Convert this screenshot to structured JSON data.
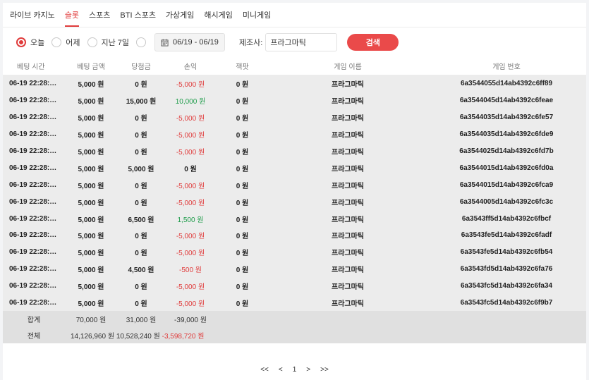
{
  "tabs": [
    {
      "label": "라이브 카지노",
      "active": false
    },
    {
      "label": "슬롯",
      "active": true
    },
    {
      "label": "스포츠",
      "active": false
    },
    {
      "label": "BTI 스포츠",
      "active": false
    },
    {
      "label": "가상게임",
      "active": false
    },
    {
      "label": "해시게임",
      "active": false
    },
    {
      "label": "미니게임",
      "active": false
    }
  ],
  "filters": {
    "today": "오늘",
    "yesterday": "어제",
    "last7": "지난 7일",
    "date_range": "06/19 - 06/19",
    "maker_label": "제조사:",
    "maker_value": "프라그마틱",
    "search_label": "검색"
  },
  "table": {
    "headers": [
      "베팅 시간",
      "베팅 금액",
      "당첨금",
      "손익",
      "잭팟",
      "게임 이름",
      "게임 번호"
    ],
    "rows": [
      [
        "06-19 22:28:…",
        "5,000 원",
        "0 원",
        "-5,000 원",
        "0 원",
        "프라그마틱",
        "6a3544055d14ab4392c6ff89"
      ],
      [
        "06-19 22:28:…",
        "5,000 원",
        "15,000 원",
        "10,000 원",
        "0 원",
        "프라그마틱",
        "6a3544045d14ab4392c6feae"
      ],
      [
        "06-19 22:28:…",
        "5,000 원",
        "0 원",
        "-5,000 원",
        "0 원",
        "프라그마틱",
        "6a3544035d14ab4392c6fe57"
      ],
      [
        "06-19 22:28:…",
        "5,000 원",
        "0 원",
        "-5,000 원",
        "0 원",
        "프라그마틱",
        "6a3544035d14ab4392c6fde9"
      ],
      [
        "06-19 22:28:…",
        "5,000 원",
        "0 원",
        "-5,000 원",
        "0 원",
        "프라그마틱",
        "6a3544025d14ab4392c6fd7b"
      ],
      [
        "06-19 22:28:…",
        "5,000 원",
        "5,000 원",
        "0 원",
        "0 원",
        "프라그마틱",
        "6a3544015d14ab4392c6fd0a"
      ],
      [
        "06-19 22:28:…",
        "5,000 원",
        "0 원",
        "-5,000 원",
        "0 원",
        "프라그마틱",
        "6a3544015d14ab4392c6fca9"
      ],
      [
        "06-19 22:28:…",
        "5,000 원",
        "0 원",
        "-5,000 원",
        "0 원",
        "프라그마틱",
        "6a3544005d14ab4392c6fc3c"
      ],
      [
        "06-19 22:28:…",
        "5,000 원",
        "6,500 원",
        "1,500 원",
        "0 원",
        "프라그마틱",
        "6a3543ff5d14ab4392c6fbcf"
      ],
      [
        "06-19 22:28:…",
        "5,000 원",
        "0 원",
        "-5,000 원",
        "0 원",
        "프라그마틱",
        "6a3543fe5d14ab4392c6fadf"
      ],
      [
        "06-19 22:28:…",
        "5,000 원",
        "0 원",
        "-5,000 원",
        "0 원",
        "프라그마틱",
        "6a3543fe5d14ab4392c6fb54"
      ],
      [
        "06-19 22:28:…",
        "5,000 원",
        "4,500 원",
        "-500 원",
        "0 원",
        "프라그마틱",
        "6a3543fd5d14ab4392c6fa76"
      ],
      [
        "06-19 22:28:…",
        "5,000 원",
        "0 원",
        "-5,000 원",
        "0 원",
        "프라그마틱",
        "6a3543fc5d14ab4392c6fa34"
      ],
      [
        "06-19 22:28:…",
        "5,000 원",
        "0 원",
        "-5,000 원",
        "0 원",
        "프라그마틱",
        "6a3543fc5d14ab4392c6f9b7"
      ]
    ],
    "subtotal": {
      "label": "합계",
      "bet": "70,000 원",
      "win": "31,000 원",
      "profit": "-39,000 원"
    },
    "total": {
      "label": "전체",
      "bet": "14,126,960 원",
      "win": "10,528,240 원",
      "profit": "-3,598,720 원"
    }
  },
  "pager": {
    "first": "<<",
    "prev": "<",
    "page": "1",
    "next": ">",
    "last": ">>"
  },
  "colors": {
    "accent": "#e03b3b",
    "positive": "#1e9c4a",
    "button": "#ea4a4a"
  }
}
